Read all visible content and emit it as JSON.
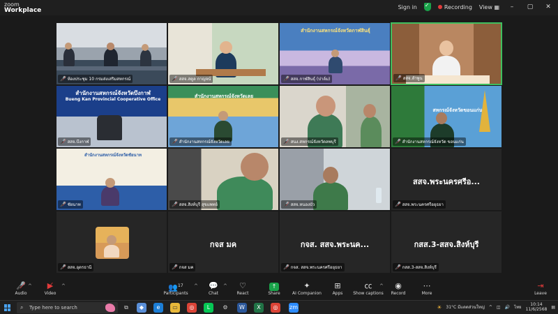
{
  "app": {
    "logo_line1": "zoom",
    "logo_line2": "Workplace"
  },
  "titlebar": {
    "signin": "Sign in",
    "recording": "Recording",
    "view": "View",
    "minimize": "–",
    "maximize": "▢",
    "close": "✕"
  },
  "tiles": [
    {
      "label": "ห้องประชุม 10 กรมส่งเสริมสหกรณ์",
      "muted": true
    },
    {
      "label": "สสจ.สตูล กาญจน์",
      "muted": true
    },
    {
      "label": "สสจ.กาฬสินธุ์ (ปาล์ม)",
      "muted": true
    },
    {
      "label": "สสจ.ลำพูน",
      "muted": true
    },
    {
      "label": "สสจ.บึงกาฬ",
      "muted": true,
      "banner_th": "สำนักงานสหกรณ์จังหวัดบึงกาฬ",
      "banner_en": "Bueng Kan Provincial Cooperative Office"
    },
    {
      "label": "สำนักงานสหกรณ์จังหวัดเลย",
      "muted": true
    },
    {
      "label": "สนง.สหกรณ์จังหวัดลพบุรี",
      "muted": true
    },
    {
      "label": "สำนักงานสหกรณ์จังหวัด ขอนแก่น",
      "muted": true,
      "banner_th": "สหกรณ์จังหวัดขอนแก่น"
    },
    {
      "label": "ชัยนาท",
      "muted": true
    },
    {
      "label": "สสจ.สิงห์บุรี สุขแพทย์",
      "muted": true
    },
    {
      "label": "สสจ.หนองบัว",
      "muted": true
    },
    {
      "label": "สสจ.พระนครศรีอยุธยา",
      "muted": true,
      "bigname": "สสจ.พระนครศรีอ..."
    },
    {
      "label": "สสจ.อุดรธานี",
      "muted": true
    },
    {
      "label": "กจส มค",
      "muted": true,
      "bigname": "กจส มค"
    },
    {
      "label": "กจส. สสจ.พระนครศรีอยุธยา",
      "muted": true,
      "bigname": "กจส. สสจ.พระนค..."
    },
    {
      "label": "กสส.3-สสจ.สิงห์บุรี",
      "muted": true,
      "bigname": "กสส.3-สสจ.สิงห์บุรี"
    }
  ],
  "toolbar": {
    "audio": "Audio",
    "video": "Video",
    "participants": "Participants",
    "participants_count": "17",
    "chat": "Chat",
    "react": "React",
    "share": "Share",
    "ai": "AI Companion",
    "apps": "Apps",
    "captions": "Show captions",
    "record": "Record",
    "more": "More",
    "leave": "Leave"
  },
  "taskbar": {
    "search_placeholder": "Type here to search",
    "weather": "31°C มีแดดส่วนใหญ่",
    "lang": "ไทย",
    "time": "10:14",
    "date": "11/6/2568"
  },
  "colors": {
    "active_border": "#3fbf5f",
    "muted_red": "#e23b3b",
    "share_green": "#1aa34a"
  }
}
